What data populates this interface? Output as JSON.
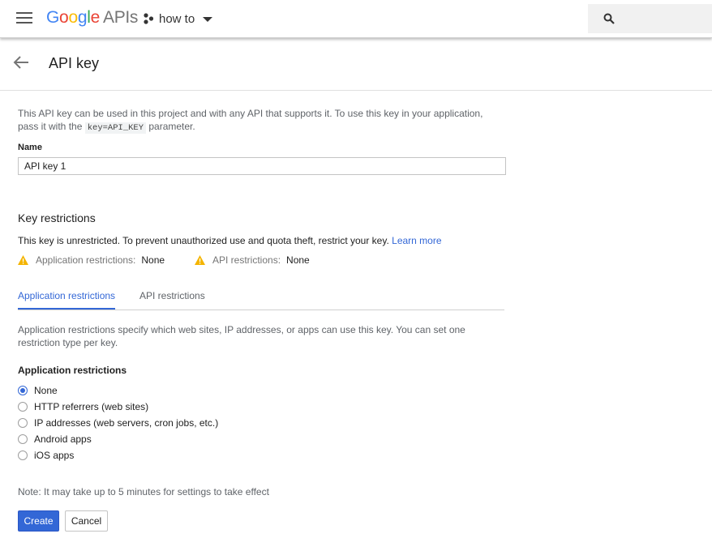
{
  "topbar": {
    "logo_google": [
      "G",
      "o",
      "o",
      "g",
      "l",
      "e"
    ],
    "logo_apis": "APIs",
    "project_name": "how to",
    "search_placeholder": ""
  },
  "page": {
    "title": "API key"
  },
  "form": {
    "desc_part1": "This API key can be used in this project and with any API that supports it. To use this key in your application, pass it with the ",
    "desc_code": "key=API_KEY",
    "desc_part2": " parameter.",
    "name_label": "Name",
    "name_value": "API key 1"
  },
  "restrictions": {
    "title": "Key restrictions",
    "unrestricted_text": "This key is unrestricted. To prevent unauthorized use and quota theft, restrict your key. ",
    "learn_more": "Learn more",
    "app_label": "Application restrictions:",
    "app_value": "None",
    "api_label": "API restrictions:",
    "api_value": "None"
  },
  "tabs": [
    {
      "label": "Application restrictions",
      "active": true
    },
    {
      "label": "API restrictions",
      "active": false
    }
  ],
  "tab_content": {
    "description": "Application restrictions specify which web sites, IP addresses, or apps can use this key. You can set one restriction type per key.",
    "heading": "Application restrictions",
    "options": [
      {
        "label": "None",
        "checked": true
      },
      {
        "label": "HTTP referrers (web sites)",
        "checked": false
      },
      {
        "label": "IP addresses (web servers, cron jobs, etc.)",
        "checked": false
      },
      {
        "label": "Android apps",
        "checked": false
      },
      {
        "label": "iOS apps",
        "checked": false
      }
    ]
  },
  "note": "Note: It may take up to 5 minutes for settings to take effect",
  "buttons": {
    "create": "Create",
    "cancel": "Cancel"
  },
  "colors": {
    "accent": "#3367d6",
    "warning": "#f4b400"
  }
}
